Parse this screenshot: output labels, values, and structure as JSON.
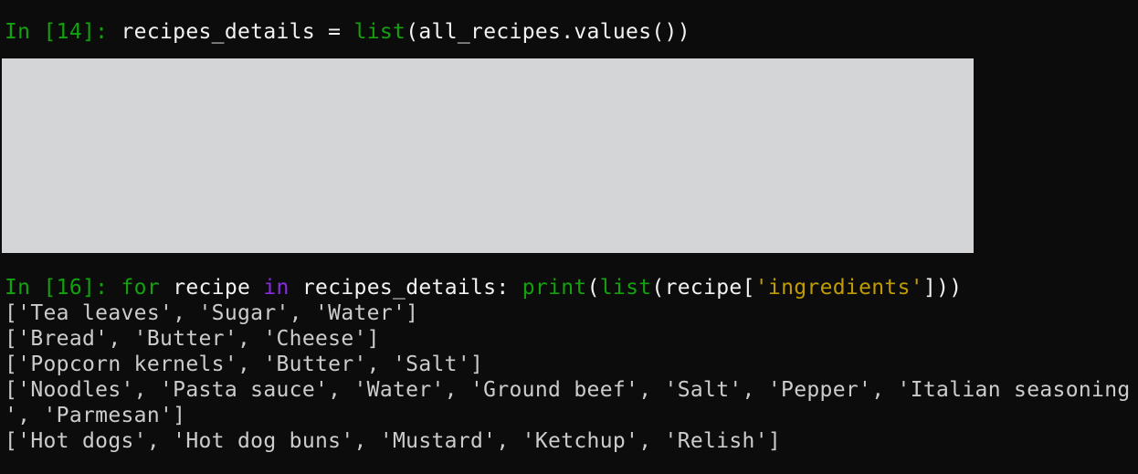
{
  "colors": {
    "background": "#0c0c0c",
    "text": "#cccccc",
    "prompt": "#13a10e",
    "builtin": "#13a10e",
    "keyword": "#8a2be2",
    "string": "#c19c00",
    "redacted_block": "#d4d5d7"
  },
  "cell1": {
    "prompt": "In [14]:",
    "pre": " recipes_details = ",
    "builtin": "list",
    "post": "(all_recipes.values())"
  },
  "cell2": {
    "prompt": "In [16]:",
    "space1": " ",
    "kw_for": "for",
    "mid1": " recipe ",
    "kw_in": "in",
    "mid2": " recipes_details: ",
    "print": "print",
    "paren1": "(",
    "list": "list",
    "mid3": "(recipe[",
    "string": "'ingredients'",
    "end": "]))"
  },
  "output": [
    "['Tea leaves', 'Sugar', 'Water']",
    "['Bread', 'Butter', 'Cheese']",
    "['Popcorn kernels', 'Butter', 'Salt']",
    "['Noodles', 'Pasta sauce', 'Water', 'Ground beef', 'Salt', 'Pepper', 'Italian seasoning",
    "', 'Parmesan']",
    "['Hot dogs', 'Hot dog buns', 'Mustard', 'Ketchup', 'Relish']"
  ]
}
